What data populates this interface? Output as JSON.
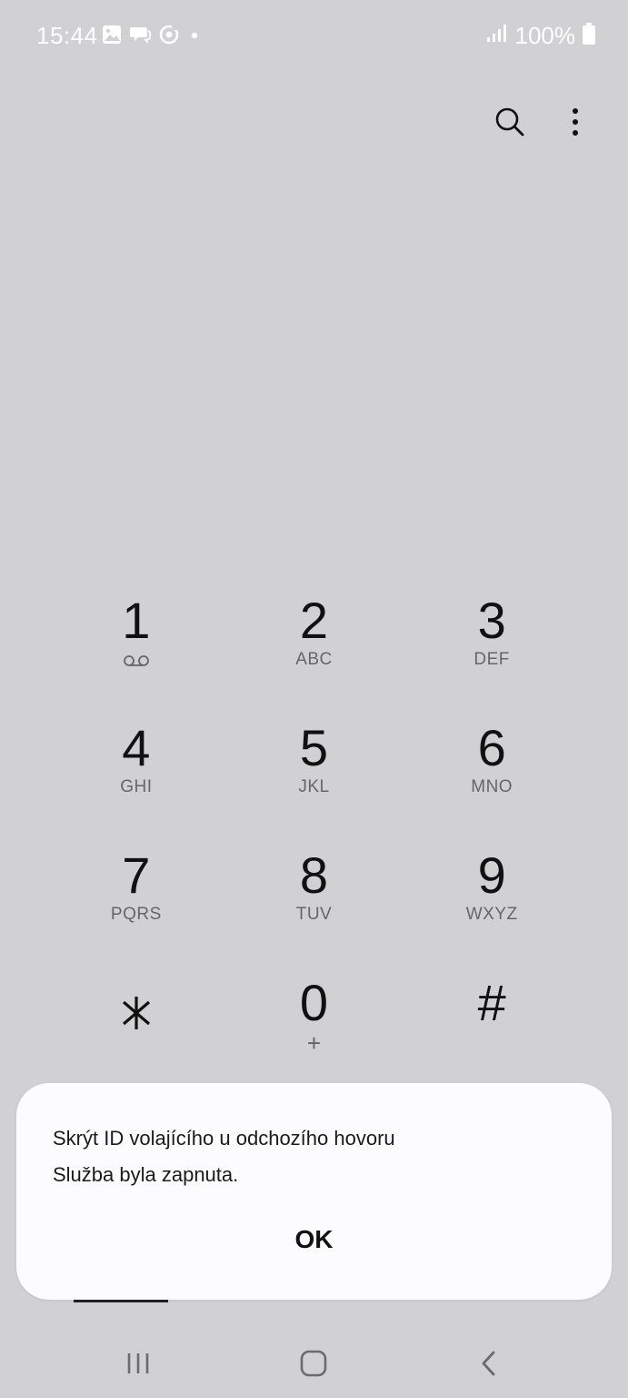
{
  "status": {
    "time": "15:44",
    "battery": "100%",
    "icons": [
      "gallery-icon",
      "chat-icon",
      "sync-icon",
      "dot-icon",
      "signal-icon",
      "battery-icon"
    ]
  },
  "toolbar": {
    "icons": [
      "search-icon",
      "more-options-icon"
    ]
  },
  "keypad": {
    "keys": [
      {
        "digit": "1",
        "sub": ""
      },
      {
        "digit": "2",
        "sub": "ABC"
      },
      {
        "digit": "3",
        "sub": "DEF"
      },
      {
        "digit": "4",
        "sub": "GHI"
      },
      {
        "digit": "5",
        "sub": "JKL"
      },
      {
        "digit": "6",
        "sub": "MNO"
      },
      {
        "digit": "7",
        "sub": "PQRS"
      },
      {
        "digit": "8",
        "sub": "TUV"
      },
      {
        "digit": "9",
        "sub": "WXYZ"
      },
      {
        "digit": "*",
        "sub": ""
      },
      {
        "digit": "0",
        "sub": "+"
      },
      {
        "digit": "#",
        "sub": ""
      }
    ]
  },
  "dialog": {
    "title": "Skrýt ID volajícího u odchozího hovoru",
    "message": "Služba byla zapnuta.",
    "ok_label": "OK"
  },
  "navbar": {
    "icons": [
      "recent-apps-icon",
      "home-icon",
      "back-icon"
    ]
  },
  "colors": {
    "background": "#d1d1d3",
    "dialog_background": "#fcfcfe",
    "text": "#111111",
    "subtext": "#666666"
  }
}
